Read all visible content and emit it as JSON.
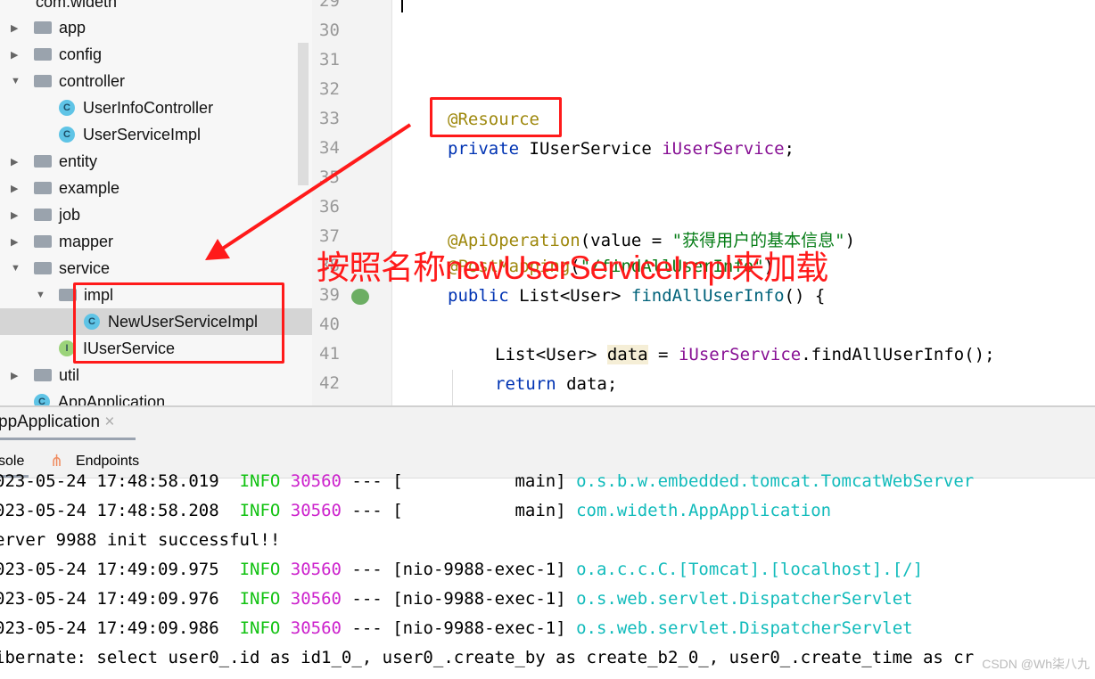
{
  "tree": {
    "root": "com.wideth",
    "items": [
      {
        "label": "app",
        "type": "folder"
      },
      {
        "label": "config",
        "type": "folder"
      },
      {
        "label": "controller",
        "type": "folder",
        "open": true
      },
      {
        "label": "UserInfoController",
        "type": "class"
      },
      {
        "label": "UserServiceImpl",
        "type": "class"
      },
      {
        "label": "entity",
        "type": "folder"
      },
      {
        "label": "example",
        "type": "folder"
      },
      {
        "label": "job",
        "type": "folder"
      },
      {
        "label": "mapper",
        "type": "folder"
      },
      {
        "label": "service",
        "type": "folder",
        "open": true
      },
      {
        "label": "impl",
        "type": "folder",
        "open": true
      },
      {
        "label": "NewUserServiceImpl",
        "type": "class",
        "selected": true
      },
      {
        "label": "IUserService",
        "type": "interface"
      },
      {
        "label": "util",
        "type": "folder"
      },
      {
        "label": "AppApplication",
        "type": "class"
      }
    ]
  },
  "editor": {
    "line_numbers": [
      "29",
      "30",
      "31",
      "32",
      "33",
      "34",
      "35",
      "36",
      "37",
      "38",
      "39",
      "40",
      "41",
      "42"
    ],
    "code": {
      "l33": "@Resource",
      "l34a": "private ",
      "l34b": "IUserService ",
      "l34c": "iUserService",
      "l34d": ";",
      "l37a": "@ApiOperation",
      "l37b": "(value = ",
      "l37c": "\"获得用户的基本信息\"",
      "l37d": ")",
      "l38a": "@PostMapping",
      "l38b": "(",
      "l38c": "\"/findAllUserInfo\"",
      "l38d": ")",
      "l39a": "public ",
      "l39b": "List<User> ",
      "l39c": "findAllUserInfo",
      "l39d": "() {",
      "l41a": "List<User> ",
      "l41b": "data",
      "l41c": " = ",
      "l41d": "iUserService",
      "l41e": ".findAllUserInfo();",
      "l42a": "return ",
      "l42b": "data;"
    }
  },
  "run": {
    "tab": "ppApplication",
    "tab_close": "×",
    "console_tab": "sole",
    "endpoints_tab": "Endpoints"
  },
  "console": [
    {
      "ts": "023-05-24 17:48:58.019",
      "lvl": "INFO",
      "pid": "30560",
      "sep": " --- ",
      "thread": "[           main]",
      "logger": "o.s.b.w.embedded.tomcat.TomcatWebServer"
    },
    {
      "ts": "023-05-24 17:48:58.208",
      "lvl": "INFO",
      "pid": "30560",
      "sep": " --- ",
      "thread": "[           main]",
      "logger": "com.wideth.AppApplication"
    },
    {
      "text": "erver 9988 init successful!!"
    },
    {
      "ts": "023-05-24 17:49:09.975",
      "lvl": "INFO",
      "pid": "30560",
      "sep": " --- ",
      "thread": "[nio-9988-exec-1]",
      "logger": "o.a.c.c.C.[Tomcat].[localhost].[/]"
    },
    {
      "ts": "023-05-24 17:49:09.976",
      "lvl": "INFO",
      "pid": "30560",
      "sep": " --- ",
      "thread": "[nio-9988-exec-1]",
      "logger": "o.s.web.servlet.DispatcherServlet"
    },
    {
      "ts": "023-05-24 17:49:09.986",
      "lvl": "INFO",
      "pid": "30560",
      "sep": " --- ",
      "thread": "[nio-9988-exec-1]",
      "logger": "o.s.web.servlet.DispatcherServlet"
    },
    {
      "text": "ibernate: select user0_.id as id1_0_, user0_.create_by as create_b2_0_, user0_.create_time as cr"
    }
  ],
  "annotation": {
    "note": "按照名称newUserServiceImpl来加载",
    "color": "#ff1a1a"
  },
  "watermark": "CSDN @Wh柒八九"
}
